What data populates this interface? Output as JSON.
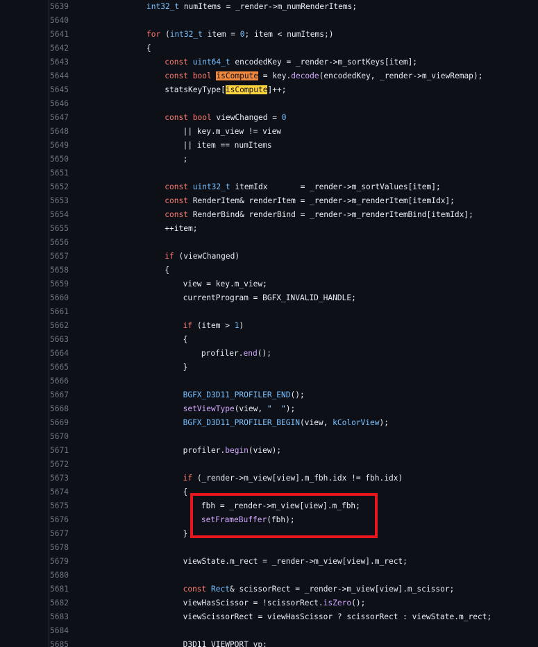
{
  "lines": [
    {
      "num": "5639",
      "indent": 0,
      "tokens": [
        {
          "c": "t",
          "v": "int32_t"
        },
        {
          "c": "p",
          "v": " numItems = _render->m_numRenderItems;"
        }
      ]
    },
    {
      "num": "5640",
      "indent": 0,
      "tokens": []
    },
    {
      "num": "5641",
      "indent": 0,
      "tokens": [
        {
          "c": "k",
          "v": "for"
        },
        {
          "c": "p",
          "v": " ("
        },
        {
          "c": "t",
          "v": "int32_t"
        },
        {
          "c": "p",
          "v": " item = "
        },
        {
          "c": "n",
          "v": "0"
        },
        {
          "c": "p",
          "v": "; item < numItems;)"
        }
      ]
    },
    {
      "num": "5642",
      "indent": 0,
      "tokens": [
        {
          "c": "p",
          "v": "{"
        }
      ]
    },
    {
      "num": "5643",
      "indent": 1,
      "tokens": [
        {
          "c": "k",
          "v": "const"
        },
        {
          "c": "p",
          "v": " "
        },
        {
          "c": "t",
          "v": "uint64_t"
        },
        {
          "c": "p",
          "v": " encodedKey = _render->m_sortKeys[item];"
        }
      ]
    },
    {
      "num": "5644",
      "indent": 1,
      "tokens": [
        {
          "c": "k",
          "v": "const"
        },
        {
          "c": "p",
          "v": " "
        },
        {
          "c": "k",
          "v": "bool"
        },
        {
          "c": "p",
          "v": " "
        },
        {
          "c": "hl-orange",
          "v": "isCompute"
        },
        {
          "c": "p",
          "v": " = key."
        },
        {
          "c": "f",
          "v": "decode"
        },
        {
          "c": "p",
          "v": "(encodedKey, _render->m_viewRemap);"
        }
      ]
    },
    {
      "num": "5645",
      "indent": 1,
      "tokens": [
        {
          "c": "p",
          "v": "statsKeyType["
        },
        {
          "c": "hl-yellow",
          "v": "isCompute"
        },
        {
          "c": "p",
          "v": "]++;"
        }
      ]
    },
    {
      "num": "5646",
      "indent": 0,
      "tokens": []
    },
    {
      "num": "5647",
      "indent": 1,
      "tokens": [
        {
          "c": "k",
          "v": "const"
        },
        {
          "c": "p",
          "v": " "
        },
        {
          "c": "k",
          "v": "bool"
        },
        {
          "c": "p",
          "v": " viewChanged = "
        },
        {
          "c": "n",
          "v": "0"
        }
      ]
    },
    {
      "num": "5648",
      "indent": 2,
      "tokens": [
        {
          "c": "p",
          "v": "|| key.m_view != view"
        }
      ]
    },
    {
      "num": "5649",
      "indent": 2,
      "tokens": [
        {
          "c": "p",
          "v": "|| item == numItems"
        }
      ]
    },
    {
      "num": "5650",
      "indent": 2,
      "tokens": [
        {
          "c": "p",
          "v": ";"
        }
      ]
    },
    {
      "num": "5651",
      "indent": 0,
      "tokens": []
    },
    {
      "num": "5652",
      "indent": 1,
      "tokens": [
        {
          "c": "k",
          "v": "const"
        },
        {
          "c": "p",
          "v": " "
        },
        {
          "c": "t",
          "v": "uint32_t"
        },
        {
          "c": "p",
          "v": " itemIdx       = _render->m_sortValues[item];"
        }
      ]
    },
    {
      "num": "5653",
      "indent": 1,
      "tokens": [
        {
          "c": "k",
          "v": "const"
        },
        {
          "c": "p",
          "v": " RenderItem& renderItem = _render->m_renderItem[itemIdx];"
        }
      ]
    },
    {
      "num": "5654",
      "indent": 1,
      "tokens": [
        {
          "c": "k",
          "v": "const"
        },
        {
          "c": "p",
          "v": " RenderBind& renderBind = _render->m_renderItemBind[itemIdx];"
        }
      ]
    },
    {
      "num": "5655",
      "indent": 1,
      "tokens": [
        {
          "c": "p",
          "v": "++item;"
        }
      ]
    },
    {
      "num": "5656",
      "indent": 0,
      "tokens": []
    },
    {
      "num": "5657",
      "indent": 1,
      "tokens": [
        {
          "c": "k",
          "v": "if"
        },
        {
          "c": "p",
          "v": " (viewChanged)"
        }
      ]
    },
    {
      "num": "5658",
      "indent": 1,
      "tokens": [
        {
          "c": "p",
          "v": "{"
        }
      ]
    },
    {
      "num": "5659",
      "indent": 2,
      "tokens": [
        {
          "c": "p",
          "v": "view = key.m_view;"
        }
      ]
    },
    {
      "num": "5660",
      "indent": 2,
      "tokens": [
        {
          "c": "p",
          "v": "currentProgram = BGFX_INVALID_HANDLE;"
        }
      ]
    },
    {
      "num": "5661",
      "indent": 0,
      "tokens": []
    },
    {
      "num": "5662",
      "indent": 2,
      "tokens": [
        {
          "c": "k",
          "v": "if"
        },
        {
          "c": "p",
          "v": " (item > "
        },
        {
          "c": "n",
          "v": "1"
        },
        {
          "c": "p",
          "v": ")"
        }
      ]
    },
    {
      "num": "5663",
      "indent": 2,
      "tokens": [
        {
          "c": "p",
          "v": "{"
        }
      ]
    },
    {
      "num": "5664",
      "indent": 3,
      "tokens": [
        {
          "c": "p",
          "v": "profiler."
        },
        {
          "c": "f",
          "v": "end"
        },
        {
          "c": "p",
          "v": "();"
        }
      ]
    },
    {
      "num": "5665",
      "indent": 2,
      "tokens": [
        {
          "c": "p",
          "v": "}"
        }
      ]
    },
    {
      "num": "5666",
      "indent": 0,
      "tokens": []
    },
    {
      "num": "5667",
      "indent": 2,
      "tokens": [
        {
          "c": "m",
          "v": "BGFX_D3D11_PROFILER_END"
        },
        {
          "c": "p",
          "v": "();"
        }
      ]
    },
    {
      "num": "5668",
      "indent": 2,
      "tokens": [
        {
          "c": "f",
          "v": "setViewType"
        },
        {
          "c": "p",
          "v": "(view, "
        },
        {
          "c": "s",
          "v": "\"  \""
        },
        {
          "c": "p",
          "v": ");"
        }
      ]
    },
    {
      "num": "5669",
      "indent": 2,
      "tokens": [
        {
          "c": "m",
          "v": "BGFX_D3D11_PROFILER_BEGIN"
        },
        {
          "c": "p",
          "v": "(view, "
        },
        {
          "c": "t",
          "v": "kColorView"
        },
        {
          "c": "p",
          "v": ");"
        }
      ]
    },
    {
      "num": "5670",
      "indent": 0,
      "tokens": []
    },
    {
      "num": "5671",
      "indent": 2,
      "tokens": [
        {
          "c": "p",
          "v": "profiler."
        },
        {
          "c": "f",
          "v": "begin"
        },
        {
          "c": "p",
          "v": "(view);"
        }
      ]
    },
    {
      "num": "5672",
      "indent": 0,
      "tokens": []
    },
    {
      "num": "5673",
      "indent": 2,
      "tokens": [
        {
          "c": "k",
          "v": "if"
        },
        {
          "c": "p",
          "v": " (_render->m_view[view].m_fbh.idx != fbh.idx)"
        }
      ]
    },
    {
      "num": "5674",
      "indent": 2,
      "tokens": [
        {
          "c": "p",
          "v": "{"
        }
      ]
    },
    {
      "num": "5675",
      "indent": 3,
      "tokens": [
        {
          "c": "p",
          "v": "fbh = _render->m_view[view].m_fbh;"
        }
      ]
    },
    {
      "num": "5676",
      "indent": 3,
      "tokens": [
        {
          "c": "f",
          "v": "setFrameBuffer"
        },
        {
          "c": "p",
          "v": "(fbh);"
        }
      ]
    },
    {
      "num": "5677",
      "indent": 2,
      "tokens": [
        {
          "c": "p",
          "v": "}"
        }
      ]
    },
    {
      "num": "5678",
      "indent": 0,
      "tokens": []
    },
    {
      "num": "5679",
      "indent": 2,
      "tokens": [
        {
          "c": "p",
          "v": "viewState.m_rect = _render->m_view[view].m_rect;"
        }
      ]
    },
    {
      "num": "5680",
      "indent": 0,
      "tokens": []
    },
    {
      "num": "5681",
      "indent": 2,
      "tokens": [
        {
          "c": "k",
          "v": "const"
        },
        {
          "c": "p",
          "v": " "
        },
        {
          "c": "t",
          "v": "Rect"
        },
        {
          "c": "p",
          "v": "& scissorRect = _render->m_view[view].m_scissor;"
        }
      ]
    },
    {
      "num": "5682",
      "indent": 2,
      "tokens": [
        {
          "c": "p",
          "v": "viewHasScissor = !scissorRect."
        },
        {
          "c": "f",
          "v": "isZero"
        },
        {
          "c": "p",
          "v": "();"
        }
      ]
    },
    {
      "num": "5683",
      "indent": 2,
      "tokens": [
        {
          "c": "p",
          "v": "viewScissorRect = viewHasScissor ? scissorRect : viewState.m_rect;"
        }
      ]
    },
    {
      "num": "5684",
      "indent": 0,
      "tokens": []
    },
    {
      "num": "5685",
      "indent": 2,
      "tokens": [
        {
          "c": "p",
          "v": "D3D11_VIEWPORT vp;"
        }
      ]
    }
  ]
}
